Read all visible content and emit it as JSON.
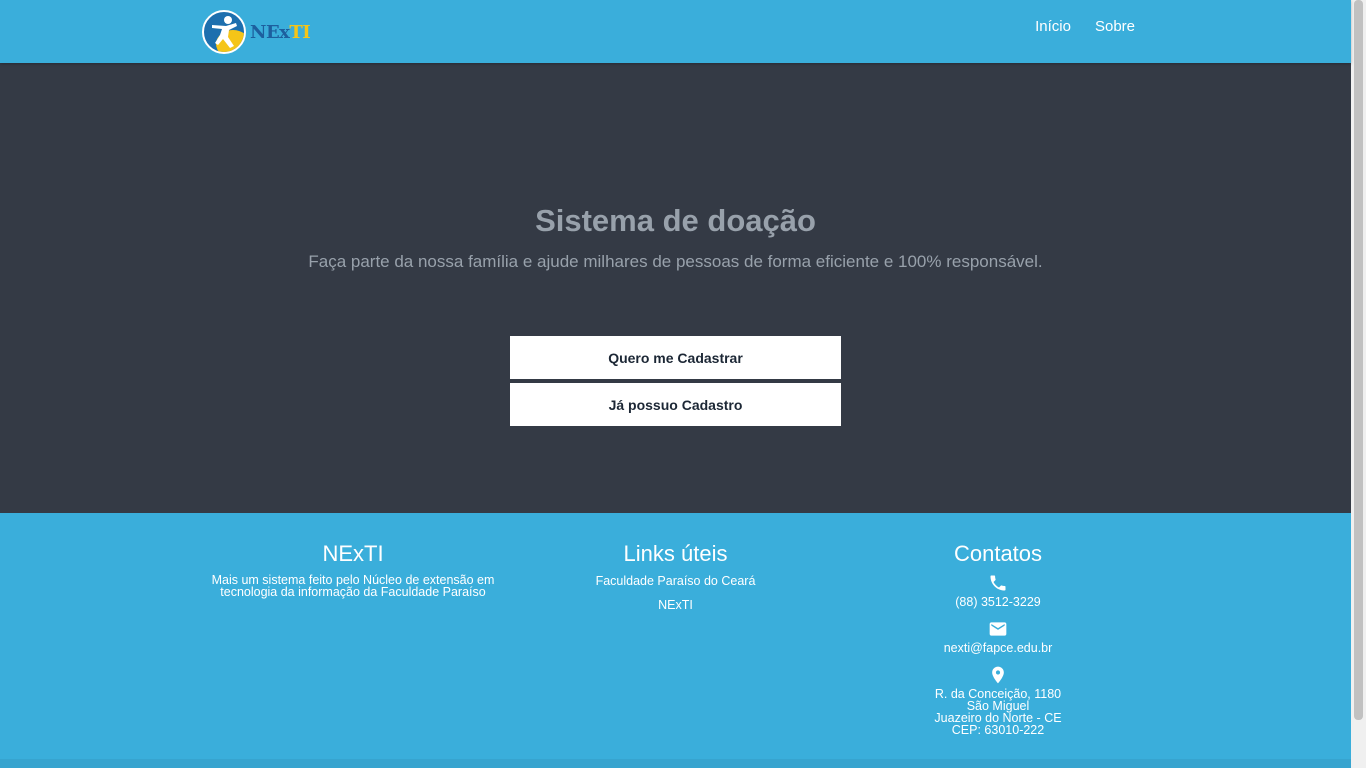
{
  "navbar": {
    "logo": {
      "text_ne": "NEx",
      "text_ti": "TI",
      "icon": "person-logo-icon"
    },
    "links": [
      {
        "label": "Início"
      },
      {
        "label": "Sobre"
      }
    ]
  },
  "hero": {
    "title": "Sistema de doação",
    "subtitle": "Faça parte da nossa família e ajude milhares de pessoas de forma eficiente e 100% responsável.",
    "buttons": {
      "signup": "Quero me Cadastrar",
      "login": "Já possuo Cadastro"
    }
  },
  "footer": {
    "about": {
      "title": "NExTI",
      "text_line1": "Mais um sistema feito pelo Núcleo de extensão em",
      "text_line2": "tecnologia da informação da Faculdade Paraíso"
    },
    "links": {
      "title": "Links úteis",
      "items": [
        {
          "label": "Faculdade Paraíso do Ceará"
        },
        {
          "label": "NExTI"
        }
      ]
    },
    "contacts": {
      "title": "Contatos",
      "phone": "(88) 3512-3229",
      "email": "nexti@fapce.edu.br",
      "address": {
        "line1": "R. da Conceição, 1180",
        "line2": "São Miguel",
        "line3": "Juazeiro do Norte - CE",
        "line4": "CEP: 63010-222"
      }
    }
  },
  "colors": {
    "primary": "#3aaedb",
    "hero_bg": "#343a45",
    "hero_text": "#98a1ab",
    "button_text": "#1c2735"
  }
}
